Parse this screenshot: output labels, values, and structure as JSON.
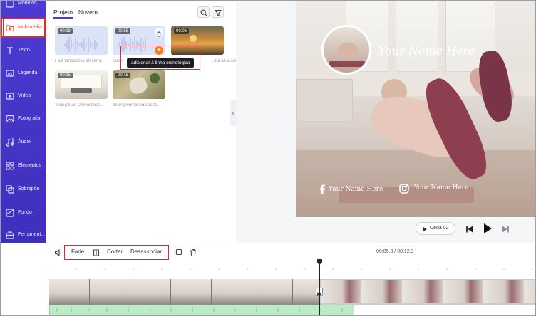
{
  "sidebar": {
    "items": [
      {
        "label": "Modelos",
        "icon": "templates-icon"
      },
      {
        "label": "Multimédia",
        "icon": "media-folder-icon",
        "active": true
      },
      {
        "label": "Texto",
        "icon": "text-icon"
      },
      {
        "label": "Legenda",
        "icon": "subtitle-icon"
      },
      {
        "label": "Vídeo",
        "icon": "video-icon"
      },
      {
        "label": "Fotografia",
        "icon": "photo-icon"
      },
      {
        "label": "Áudio",
        "icon": "music-icon"
      },
      {
        "label": "Elementos",
        "icon": "elements-icon"
      },
      {
        "label": "Sobrepõe",
        "icon": "overlay-icon"
      },
      {
        "label": "Fundo",
        "icon": "background-icon"
      },
      {
        "label": "Ferrament...",
        "icon": "tools-icon"
      }
    ]
  },
  "media_panel": {
    "tabs": [
      {
        "label": "Projeto",
        "active": true
      },
      {
        "label": "Nuvem",
        "active": false
      }
    ],
    "items": [
      {
        "duration": "00:18",
        "name": "Fast Whooshes 10 items",
        "kind": "audio"
      },
      {
        "duration": "00:55",
        "name": "Summer...",
        "kind": "audio"
      },
      {
        "duration": "00:06",
        "name": "...ba at sunset",
        "kind": "video"
      },
      {
        "duration": "00:15",
        "name": "Young Man Demonstrat...",
        "kind": "video"
      },
      {
        "duration": "00:15",
        "name": "Young woman in sports...",
        "kind": "video"
      }
    ],
    "tooltip": "adicionar à linha cronológica"
  },
  "preview": {
    "title_text": "Your Name Here",
    "facebook_text": "Your Name Here",
    "instagram_text": "Your Name Here",
    "scene_label": "Cena 02"
  },
  "timeline": {
    "fade_label": "Fade",
    "cut_label": "Cortar",
    "detach_label": "Desassociar",
    "current_time": "00:05.8",
    "total_time": "00:12.3",
    "time_display": "00:05.8 / 00:12.3"
  },
  "colors": {
    "sidebar": "#4b3bd1",
    "accent": "#ff7a1a",
    "highlight": "#e02a2a"
  }
}
